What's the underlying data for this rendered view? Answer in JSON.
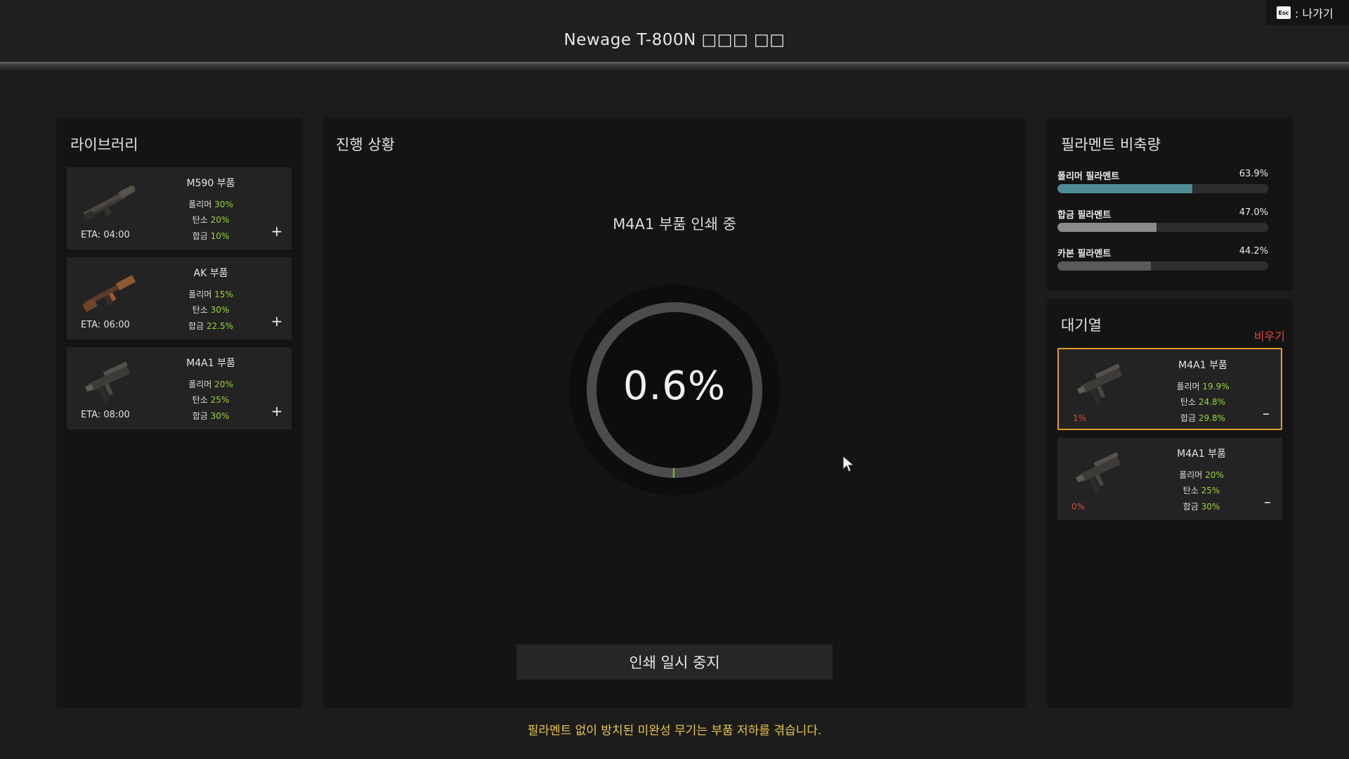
{
  "header": {
    "title": "Newage T-800N □□□ □□",
    "esc_key": "Esc",
    "esc_label": ": 나가기"
  },
  "library": {
    "title": "라이브러리",
    "items": [
      {
        "name": "M590 부품",
        "polymer_label": "폴리머",
        "polymer": "30%",
        "carbon_label": "탄소",
        "carbon": "20%",
        "alloy_label": "합금",
        "alloy": "10%",
        "eta": "ETA: 04:00",
        "icon": "shotgun-icon"
      },
      {
        "name": "AK 부품",
        "polymer_label": "폴리머",
        "polymer": "15%",
        "carbon_label": "탄소",
        "carbon": "30%",
        "alloy_label": "합금",
        "alloy": "22.5%",
        "eta": "ETA: 06:00",
        "icon": "rifle-icon"
      },
      {
        "name": "M4A1 부품",
        "polymer_label": "폴리머",
        "polymer": "20%",
        "carbon_label": "탄소",
        "carbon": "25%",
        "alloy_label": "합금",
        "alloy": "30%",
        "eta": "ETA: 08:00",
        "icon": "rifle-parts-icon"
      }
    ]
  },
  "progress": {
    "title": "진행 상황",
    "job_label": "M4A1 부품 인쇄 중",
    "percent_text": "0.6%",
    "percent_value": 0.006,
    "pause_label": "인쇄 일시 중지",
    "ring_color": "#6fbf2a"
  },
  "stock": {
    "title": "필라멘트 비축량",
    "rows": [
      {
        "label": "폴리머 필라멘트",
        "value_text": "63.9%",
        "value": 0.639,
        "color": "#4f8c93"
      },
      {
        "label": "합금 필라멘트",
        "value_text": "47.0%",
        "value": 0.47,
        "color": "#8a8a8a"
      },
      {
        "label": "카본 필라멘트",
        "value_text": "44.2%",
        "value": 0.442,
        "color": "#5a5a5a"
      }
    ]
  },
  "queue": {
    "title": "대기열",
    "clear_label": "비우기",
    "items": [
      {
        "name": "M4A1 부품",
        "polymer_label": "폴리머",
        "polymer": "19.9%",
        "carbon_label": "탄소",
        "carbon": "24.8%",
        "alloy_label": "합금",
        "alloy": "29.8%",
        "progress": "1%",
        "active": true
      },
      {
        "name": "M4A1 부품",
        "polymer_label": "폴리머",
        "polymer": "20%",
        "carbon_label": "탄소",
        "carbon": "25%",
        "alloy_label": "합금",
        "alloy": "30%",
        "progress": "0%",
        "active": false
      }
    ]
  },
  "footer": {
    "warning": "필라멘트 없이 방치된 미완성 무기는 부품 저하를 겪습니다."
  },
  "colors": {
    "accent_green": "#9ad43a",
    "active_border": "#e49a2a",
    "danger_red": "#e6453a",
    "warning_yellow": "#e8c84a"
  }
}
